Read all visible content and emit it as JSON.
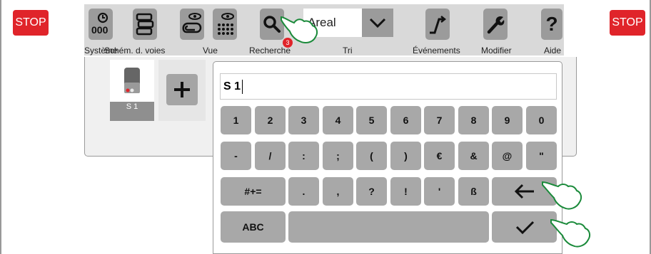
{
  "stop_left": "STOP",
  "stop_right": "STOP",
  "toolbar": {
    "systeme": "Système",
    "schema": "Schém. d. voies",
    "vue": "Vue",
    "recherche": "Recherche",
    "search_value": "Areal",
    "search_count": "3",
    "tri": "Tri",
    "evenements": "Événements",
    "modifier": "Modifier",
    "aide": "Aide"
  },
  "loco": {
    "label": "S 1"
  },
  "keyboard": {
    "input_value": "S 1",
    "row1": [
      "1",
      "2",
      "3",
      "4",
      "5",
      "6",
      "7",
      "8",
      "9",
      "0"
    ],
    "row2": [
      "-",
      "/",
      ":",
      ";",
      "(",
      ")",
      "€",
      "&",
      "@",
      "\""
    ],
    "row3": [
      "#+=",
      ".",
      ",",
      "?",
      "!",
      "'",
      "ß"
    ],
    "abc": "ABC"
  },
  "colors": {
    "stop": "#e0242a",
    "key": "#a8a8a8",
    "toolbar": "#d9d9d9"
  },
  "icons": [
    "system-icon",
    "track-diagram-icon",
    "view-icon",
    "search-icon",
    "chevron-down-icon",
    "events-icon",
    "wrench-icon",
    "help-icon",
    "plus-icon",
    "backspace-icon",
    "checkmark-icon",
    "pointing-hand-icon"
  ]
}
